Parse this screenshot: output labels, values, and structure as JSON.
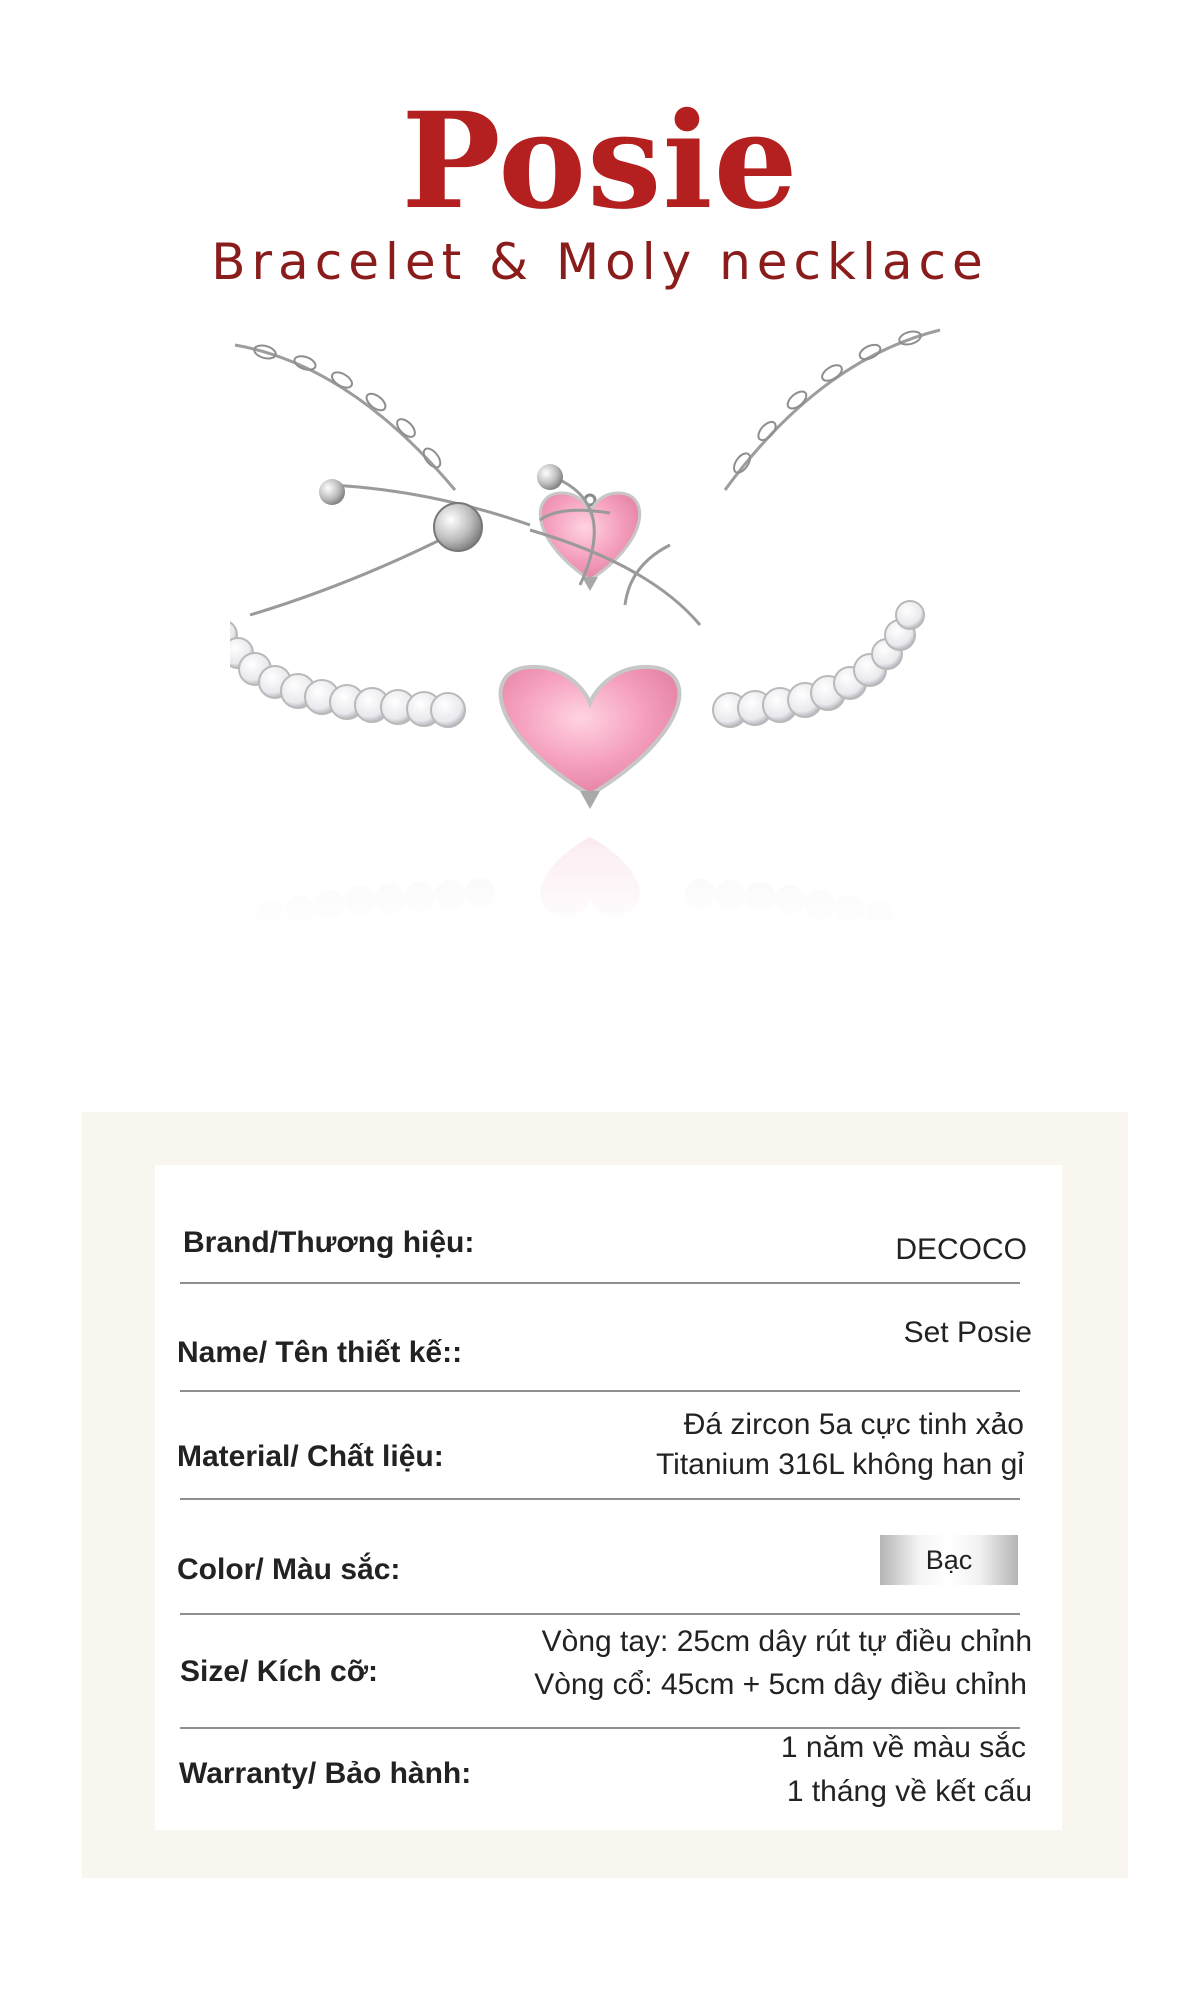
{
  "header": {
    "title": "Posie",
    "subtitle": "Bracelet & Moly necklace"
  },
  "product_image": {
    "description_icon": "jewelry-set-image",
    "colors": {
      "silver": "#c9c9c9",
      "pink_stone": "#f4a7c0"
    }
  },
  "specs": {
    "brand": {
      "label": "Brand/Thương hiệu:",
      "value": "DECOCO"
    },
    "name": {
      "label": "Name/ Tên thiết kế::",
      "value": "Set Posie"
    },
    "material": {
      "label": "Material/ Chất liệu:",
      "value_1": "Đá zircon 5a cực tinh xảo",
      "value_2": "Titanium 316L không han gỉ"
    },
    "color": {
      "label": "Color/ Màu sắc:",
      "value": "Bạc"
    },
    "size": {
      "label": "Size/ Kích cỡ:",
      "value_1": "Vòng tay: 25cm dây rút tự điều chỉnh",
      "value_2": "Vòng cổ: 45cm + 5cm dây điều chỉnh"
    },
    "warranty": {
      "label": "Warranty/ Bảo hành:",
      "value_1": "1 năm về màu sắc",
      "value_2": "1 tháng về kết cấu"
    }
  },
  "theme": {
    "title_color": "#b3201f",
    "panel_bg": "#f9f5ef",
    "card_bg": "#ffffff"
  }
}
